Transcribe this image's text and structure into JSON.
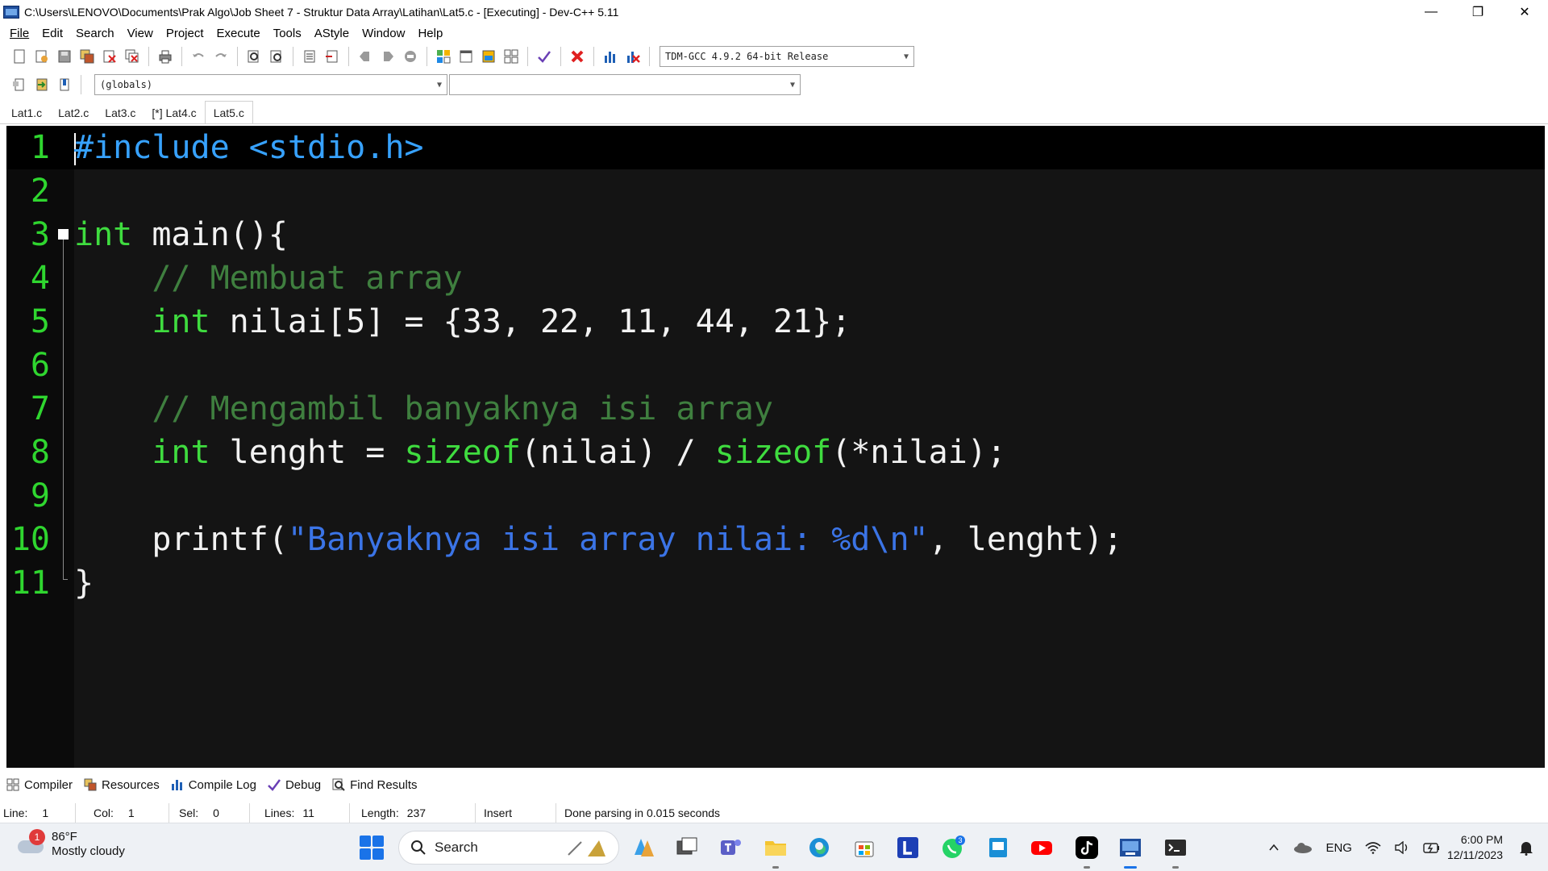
{
  "window": {
    "title": "C:\\Users\\LENOVO\\Documents\\Prak Algo\\Job Sheet 7 - Struktur Data Array\\Latihan\\Lat5.c - [Executing] - Dev-C++ 5.11",
    "minimize": "—",
    "maximize": "❐",
    "close": "✕"
  },
  "menu": [
    {
      "label": "File"
    },
    {
      "label": "Edit"
    },
    {
      "label": "Search"
    },
    {
      "label": "View"
    },
    {
      "label": "Project"
    },
    {
      "label": "Execute"
    },
    {
      "label": "Tools"
    },
    {
      "label": "AStyle"
    },
    {
      "label": "Window"
    },
    {
      "label": "Help"
    }
  ],
  "toolbar": {
    "compiler": "TDM-GCC 4.9.2 64-bit Release",
    "scope": "(globals)",
    "members": ""
  },
  "tabs": [
    {
      "label": "Lat1.c"
    },
    {
      "label": "Lat2.c"
    },
    {
      "label": "Lat3.c"
    },
    {
      "label": "[*] Lat4.c"
    },
    {
      "label": "Lat5.c"
    }
  ],
  "editor": {
    "lines": [
      {
        "n": "1",
        "parts": [
          {
            "t": "pp",
            "v": "#include <stdio.h>"
          }
        ]
      },
      {
        "n": "2",
        "parts": []
      },
      {
        "n": "3",
        "parts": [
          {
            "t": "kw",
            "v": "int"
          },
          {
            "t": "txt",
            "v": " main(){"
          }
        ]
      },
      {
        "n": "4",
        "parts": [
          {
            "t": "txt",
            "v": "    "
          },
          {
            "t": "cm",
            "v": "// Membuat array"
          }
        ]
      },
      {
        "n": "5",
        "parts": [
          {
            "t": "txt",
            "v": "    "
          },
          {
            "t": "kw",
            "v": "int"
          },
          {
            "t": "txt",
            "v": " nilai[5] = {33, 22, 11, 44, 21};"
          }
        ]
      },
      {
        "n": "6",
        "parts": []
      },
      {
        "n": "7",
        "parts": [
          {
            "t": "txt",
            "v": "    "
          },
          {
            "t": "cm",
            "v": "// Mengambil banyaknya isi array"
          }
        ]
      },
      {
        "n": "8",
        "parts": [
          {
            "t": "txt",
            "v": "    "
          },
          {
            "t": "kw",
            "v": "int"
          },
          {
            "t": "txt",
            "v": " lenght = "
          },
          {
            "t": "fn",
            "v": "sizeof"
          },
          {
            "t": "txt",
            "v": "(nilai) / "
          },
          {
            "t": "fn",
            "v": "sizeof"
          },
          {
            "t": "txt",
            "v": "(*nilai);"
          }
        ]
      },
      {
        "n": "9",
        "parts": []
      },
      {
        "n": "10",
        "parts": [
          {
            "t": "txt",
            "v": "    printf("
          },
          {
            "t": "str",
            "v": "\"Banyaknya isi array nilai: %d\\n\""
          },
          {
            "t": "txt",
            "v": ", lenght);"
          }
        ]
      },
      {
        "n": "11",
        "parts": [
          {
            "t": "txt",
            "v": "}"
          }
        ]
      }
    ]
  },
  "bottom_tabs": [
    {
      "label": "Compiler",
      "icon": "compiler-icon"
    },
    {
      "label": "Resources",
      "icon": "resources-icon"
    },
    {
      "label": "Compile Log",
      "icon": "compile-log-icon"
    },
    {
      "label": "Debug",
      "icon": "debug-icon"
    },
    {
      "label": "Find Results",
      "icon": "find-results-icon"
    }
  ],
  "status": {
    "line_label": "Line:",
    "line": "1",
    "col_label": "Col:",
    "col": "1",
    "sel_label": "Sel:",
    "sel": "0",
    "lines_label": "Lines:",
    "lines": "11",
    "length_label": "Length:",
    "length": "237",
    "mode": "Insert",
    "message": "Done parsing in 0.015 seconds"
  },
  "taskbar": {
    "weather_badge": "1",
    "temperature": "86°F",
    "condition": "Mostly cloudy",
    "search": "Search",
    "whatsapp_badge": "3",
    "language": "ENG",
    "time": "6:00 PM",
    "date": "12/11/2023"
  },
  "colors": {
    "editor_bg": "#141414",
    "line_number": "#2fd62f",
    "keyword": "#3fdc3f",
    "comment": "#3f7f3f",
    "string": "#3b74e6",
    "preprocessor": "#37a2ff"
  }
}
